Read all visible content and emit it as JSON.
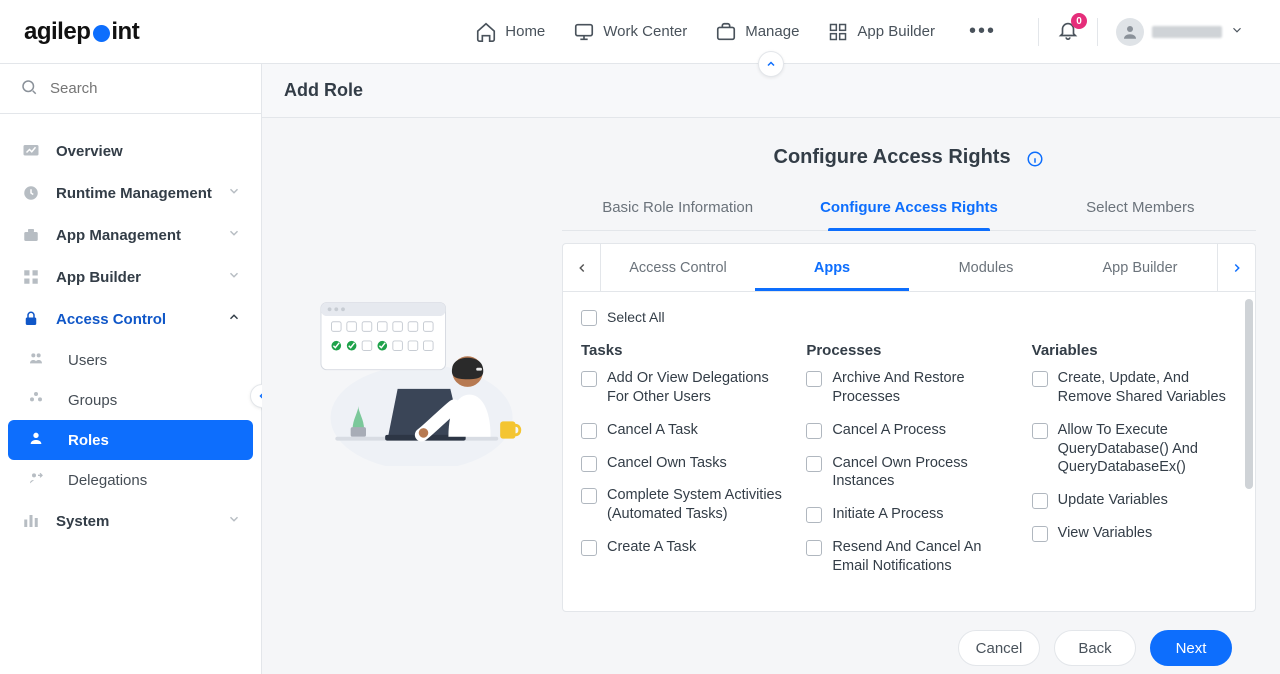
{
  "brand": {
    "pre": "agilep",
    "post": "int"
  },
  "nav": {
    "home": "Home",
    "work_center": "Work Center",
    "manage": "Manage",
    "app_builder": "App Builder"
  },
  "notifications": {
    "count": "0"
  },
  "sidebar": {
    "search_placeholder": "Search",
    "items": {
      "overview": "Overview",
      "runtime_management": "Runtime Management",
      "app_management": "App Management",
      "app_builder": "App Builder",
      "access_control": "Access Control",
      "system": "System"
    },
    "sub_items": {
      "users": "Users",
      "groups": "Groups",
      "roles": "Roles",
      "delegations": "Delegations"
    }
  },
  "page": {
    "title": "Add Role"
  },
  "panel": {
    "title": "Configure Access Rights",
    "steps": {
      "basic": "Basic Role Information",
      "configure": "Configure Access Rights",
      "members": "Select Members"
    },
    "categories": {
      "access_control": "Access Control",
      "apps": "Apps",
      "modules": "Modules",
      "app_builder": "App Builder"
    },
    "select_all": "Select All",
    "columns": {
      "tasks": {
        "heading": "Tasks",
        "items": [
          "Add Or View Delegations For Other Users",
          "Cancel A Task",
          "Cancel Own Tasks",
          "Complete System Activities (Automated Tasks)",
          "Create A Task"
        ]
      },
      "processes": {
        "heading": "Processes",
        "items": [
          "Archive And Restore Processes",
          "Cancel A Process",
          "Cancel Own Process Instances",
          "Initiate A Process",
          "Resend And Cancel An Email Notifications"
        ]
      },
      "variables": {
        "heading": "Variables",
        "items": [
          "Create, Update, And Remove Shared Variables",
          "Allow To Execute QueryDatabase() And QueryDatabaseEx()",
          "Update Variables",
          "View Variables"
        ]
      }
    },
    "buttons": {
      "cancel": "Cancel",
      "back": "Back",
      "next": "Next"
    }
  }
}
